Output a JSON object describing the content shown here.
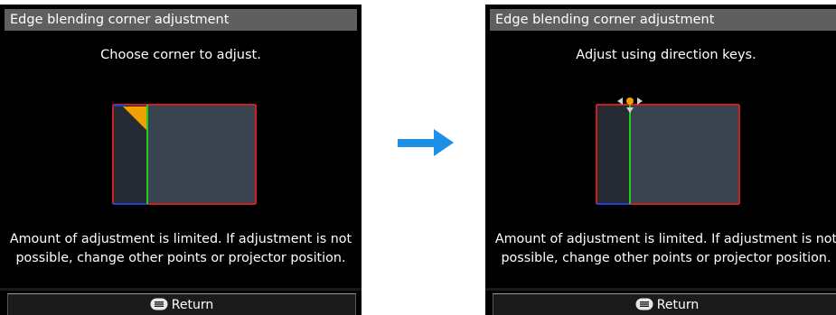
{
  "screens": [
    {
      "id": "left",
      "title": "Edge blending corner adjustment",
      "instruction": "Choose corner to adjust.",
      "warning_line1": "Amount of adjustment is limited. If adjustment is not",
      "warning_line2": "possible, change other points or projector position.",
      "return_label": "Return",
      "return_icon": "menu-button-icon",
      "diagram_state": "selected-corner-top-left"
    },
    {
      "id": "right",
      "title": "Edge blending corner adjustment",
      "instruction": "Adjust using direction keys.",
      "warning_line1": "Amount of adjustment is limited. If adjustment is not",
      "warning_line2": "possible, change other points or projector position.",
      "return_label": "Return",
      "return_icon": "menu-button-icon",
      "diagram_state": "adjusting-point-with-direction-arrows"
    }
  ],
  "transition_icon": "right-arrow-icon",
  "colors": {
    "screen_bg": "#000000",
    "title_bar": "#5f5f5f",
    "projection_area": "#3a4350",
    "blend_region": "#262b33",
    "border_red": "#cc1f1f",
    "border_blue": "#1d3fd6",
    "blend_line_green": "#22cc22",
    "corner_marker": "#f0a000",
    "direction_arrows": "#d0d0d0",
    "transition_arrow": "#1e8fe6"
  }
}
